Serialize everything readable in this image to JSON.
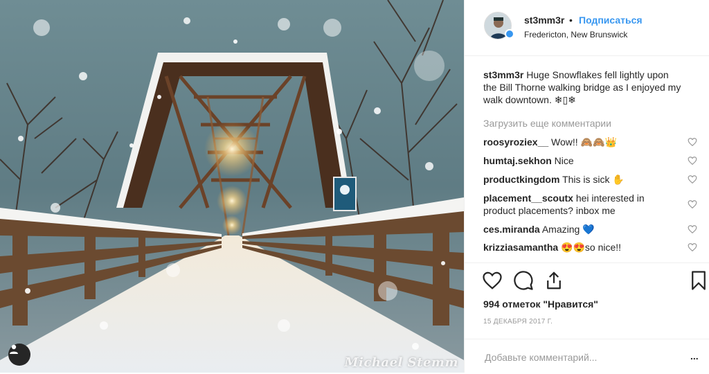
{
  "post": {
    "username": "st3mm3r",
    "separator": "•",
    "follow_label": "Подписаться",
    "location": "Fredericton, New Brunswick",
    "watermark": "Michael Stemm",
    "caption_user": "st3mm3r",
    "caption_text": " Huge Snowflakes fell lightly upon the Bill Thorne walking bridge as I enjoyed my walk downtown. ❄▯❄",
    "load_more_label": "Загрузить еще комментарии",
    "comments": [
      {
        "user": "roosyroziex__",
        "text": " Wow!! 🙈🙈👑"
      },
      {
        "user": "humtaj.sekhon",
        "text": " Nice"
      },
      {
        "user": "productkingdom",
        "text": " This is sick ✋"
      },
      {
        "user": "placement__scoutx",
        "text": " hei interested in product placements? inbox me"
      },
      {
        "user": "ces.miranda",
        "text": " Amazing 💙"
      },
      {
        "user": "krizziasamantha",
        "text": " 😍😍so nice!!"
      }
    ],
    "likes_label": "994 отметок \"Нравится\"",
    "date_label": "15 ДЕКАБРЯ 2017 Г.",
    "comment_placeholder": "Добавьте комментарий...",
    "more_label": "..."
  },
  "icons": {
    "tag": "person-tag-icon",
    "like": "heart-icon",
    "comment": "comment-bubble-icon",
    "share": "share-icon",
    "save": "bookmark-icon",
    "verified": "verified-badge-icon"
  },
  "colors": {
    "accent": "#3897f0",
    "text": "#262626",
    "muted": "#999999",
    "border": "#efefef"
  }
}
